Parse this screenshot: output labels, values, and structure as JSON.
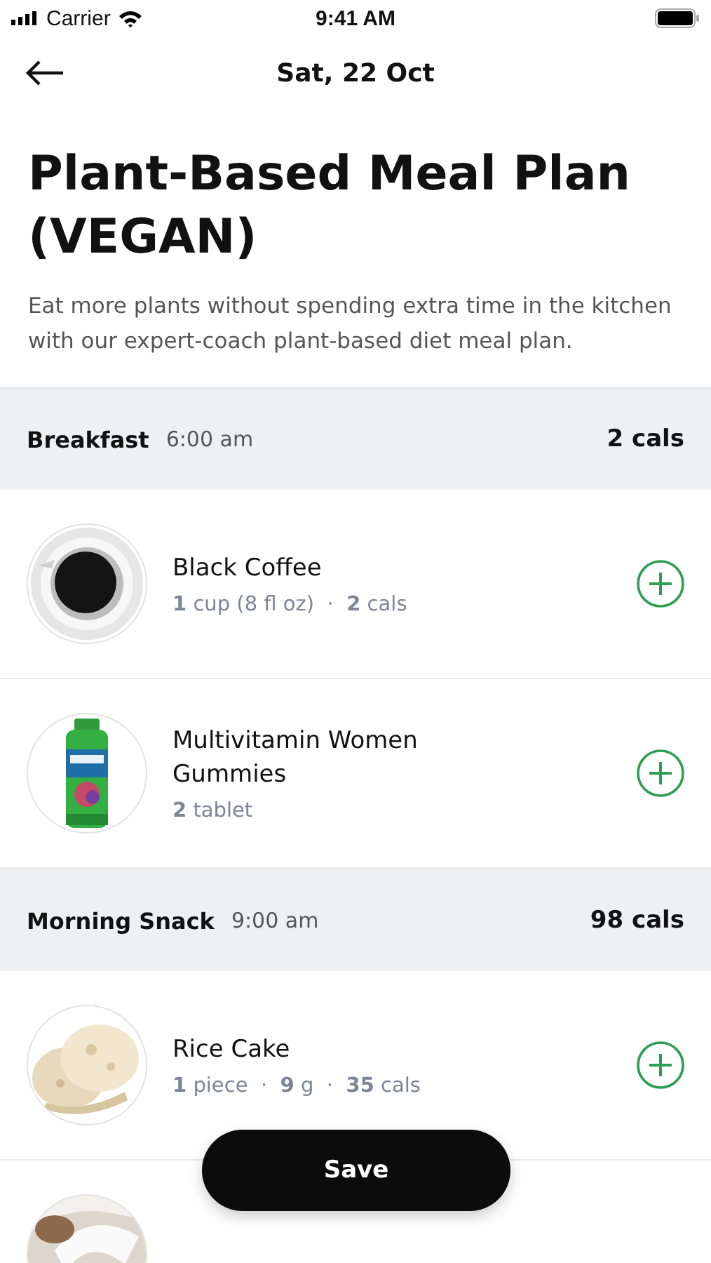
{
  "status_bar": {
    "carrier": "Carrier",
    "time": "9:41 AM"
  },
  "header": {
    "title": "Sat, 22 Oct"
  },
  "plan": {
    "title": "Plant-Based Meal Plan (VEGAN)",
    "description": "Eat more plants without spending extra time in the kitchen with our expert-coach plant-based diet meal plan."
  },
  "meals": [
    {
      "name": "Breakfast",
      "time": "6:00 am",
      "calories": "2 cals",
      "items": [
        {
          "kind": "food",
          "name": "Black Coffee",
          "detail": "**1** cup (8 fl oz)  ·  **2** cals"
        },
        {
          "kind": "food",
          "name": "Multivitamin Women Gummies",
          "detail": "**2** tablet"
        }
      ]
    },
    {
      "name": "Morning Snack",
      "time": "9:00 am",
      "calories": "98 cals",
      "items": [
        {
          "kind": "food",
          "name": "Rice Cake",
          "detail": "**1** piece  ·  **9** g  ·  **35** cals"
        },
        {
          "kind": "cut"
        }
      ]
    }
  ],
  "save_button": "Save"
}
